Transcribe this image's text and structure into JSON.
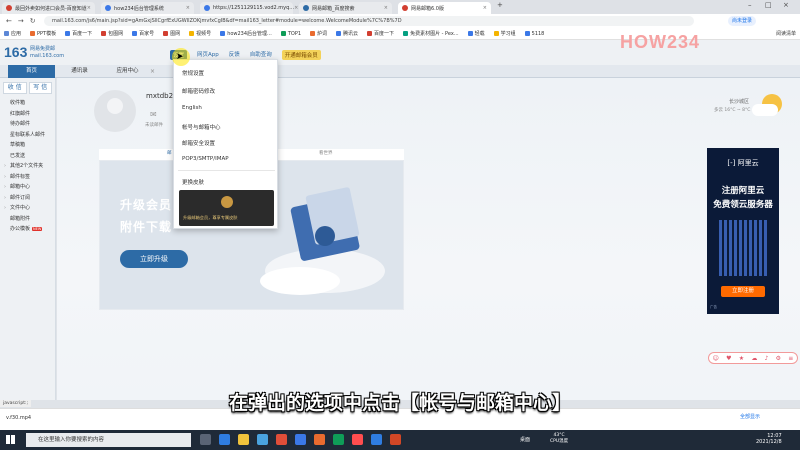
{
  "browser": {
    "tabs": [
      {
        "title": "最回外卖如何进口会员-百度知道",
        "color": "#d23f31"
      },
      {
        "title": "how234后台管理系统",
        "color": "#3b78e7"
      },
      {
        "title": "https://1251129115.vod2.myq...",
        "color": "#3b78e7"
      },
      {
        "title": "网易邮箱_百度搜索",
        "color": "#2d6ba6"
      },
      {
        "title": "网易邮箱6.0版",
        "color": "#d23f31",
        "active": true
      }
    ],
    "new_tab_label": "+",
    "window_controls": [
      "–",
      "□",
      "×"
    ],
    "url": "mail.163.com/js6/main.jsp?sid=gAmGxjSllCgrfExUGWIlZOKjmvfxCgIB&df=mail163_letter#module=welcome.WelcomeModule%7C%7B%7D",
    "login_label": "尚未登录",
    "bookmarks": [
      "应用",
      "PPT模板",
      "百度一下",
      "包图网",
      "百家号",
      "图网",
      "视频号",
      "how234后台管理...",
      "TOP1",
      "炉词",
      "腾讯云",
      "百度一下",
      "免费素材图片 - Pex...",
      "轻载",
      "学习组",
      "5118"
    ],
    "reading_list_label": "阅读清单"
  },
  "mail": {
    "logo_main": "163",
    "logo_sub_1": "网易免费邮",
    "logo_sub_2": "mail.163.com",
    "top_nav": [
      {
        "label": "设置",
        "highlight": true
      },
      {
        "label": "网页App"
      },
      {
        "label": "反馈"
      },
      {
        "label": "自助查询"
      },
      {
        "label": "开通邮箱会员",
        "vip": true
      }
    ],
    "tabs": [
      {
        "label": "首页",
        "active": true
      },
      {
        "label": "通讯录"
      },
      {
        "label": "应用中心"
      }
    ],
    "tab_close": "×",
    "sidebar": {
      "receive_label": "收 信",
      "compose_label": "写 信",
      "items": [
        {
          "label": "收件箱"
        },
        {
          "label": "红旗邮件"
        },
        {
          "label": "待办邮件"
        },
        {
          "label": "星标联系人邮件"
        },
        {
          "label": "草稿箱"
        },
        {
          "label": "已发送"
        },
        {
          "label": "其他2个文件夹",
          "arrow": true
        },
        {
          "label": "邮件标签",
          "arrow": true
        },
        {
          "label": "邮箱中心",
          "arrow": true
        },
        {
          "label": "邮件订阅",
          "arrow": true
        },
        {
          "label": "文件中心",
          "arrow": true
        },
        {
          "label": "邮箱附件"
        },
        {
          "label": "办公模板",
          "badge": "NEW"
        }
      ]
    },
    "user": {
      "name": "mxtdb22",
      "unread_label": "未读邮件"
    },
    "weather": {
      "city": "长沙城区",
      "temp": "多云 16°C ~ 8°C"
    },
    "banner": {
      "tabs": [
        "邮",
        "看世界"
      ],
      "line1": "升级会员",
      "line2": "附件下载",
      "cta": "立即升级"
    },
    "ad": {
      "brand": "[-] 阿里云",
      "headline1": "注册阿里云",
      "headline2": "免费领云服务器",
      "cta": "立即注册",
      "tag": "广告"
    }
  },
  "settings_dropdown": {
    "items": [
      "常规设置",
      "邮箱密码修改",
      "English",
      "帐号与邮箱中心",
      "邮箱安全设置",
      "POP3/SMTP/IMAP",
      "更换皮肤"
    ],
    "vip_promo": "升级邮箱会员，尊享专属皮肤"
  },
  "overlay": {
    "watermark": "HOW234",
    "subtitle": "在弹出的选项中点击【帐号与邮箱中心】"
  },
  "status_bar": {
    "text": "javascript:;"
  },
  "downloads": {
    "file": "v.f30.mp4",
    "show_all": "全部显示"
  },
  "taskbar": {
    "search_placeholder": "在这里输入你要搜索的内容",
    "desktop_label": "桌面",
    "cpu_temp": "43°C",
    "cpu_label": "CPU温度",
    "time": "12:07",
    "date": "2021/12/8"
  }
}
